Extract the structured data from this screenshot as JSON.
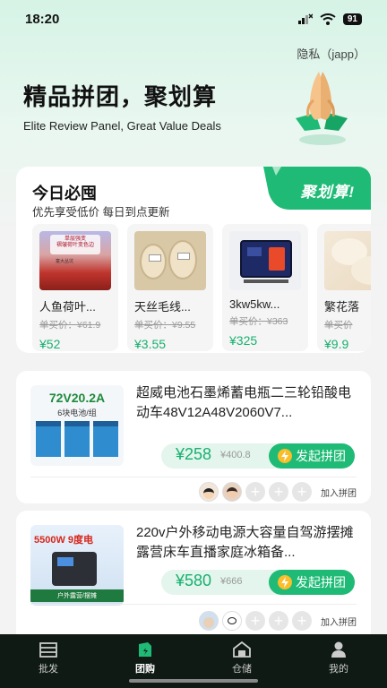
{
  "status": {
    "time": "18:20",
    "battery": "91"
  },
  "header": {
    "privacy": "隐私（japp）",
    "title": "精品拼团，聚划算",
    "subtitle": "Elite Review Panel, Great Value Deals"
  },
  "daily": {
    "title": "今日必囤",
    "subtitle": "优先享受低价 每日到点更新",
    "ribbon": "聚划算!",
    "products": [
      {
        "name": "人鱼荷叶...",
        "orig": "单买价：¥61.9",
        "price": "¥52"
      },
      {
        "name": "天丝毛线...",
        "orig": "单买价：¥9.55",
        "price": "¥3.55"
      },
      {
        "name": "3kw5kw...",
        "orig": "单买价：¥363",
        "price": "¥325"
      },
      {
        "name": "繁花落",
        "orig": "单买价",
        "price": "¥9.9"
      }
    ],
    "thumb_texts": {
      "p1a": "单层强变",
      "p1b": "褶皱荷叶变色边",
      "p1c": "童大丛坑"
    }
  },
  "deals": [
    {
      "title": "超威电池石墨烯蓄电瓶二三轮铅酸电动车48V12A48V2060V7...",
      "price": "¥258",
      "orig": "¥400.8",
      "button": "发起拼团",
      "join": "加入拼团",
      "thumb_a": "72V20.2A",
      "thumb_b": "6块电池/组"
    },
    {
      "title": "220v户外移动电源大容量自驾游摆摊露营床车直播家庭冰箱备...",
      "price": "¥580",
      "orig": "¥666",
      "button": "发起拼团",
      "join": "加入拼团",
      "thumb_a": "5500W 9度电",
      "thumb_b": "户外露营/摆摊"
    }
  ],
  "tabs": [
    {
      "label": "批发",
      "icon": "warehouse-icon"
    },
    {
      "label": "团购",
      "icon": "group-buy-icon",
      "active": true
    },
    {
      "label": "仓储",
      "icon": "home-storage-icon"
    },
    {
      "label": "我的",
      "icon": "user-icon"
    }
  ],
  "colors": {
    "accent": "#1fbb76",
    "price": "#18b070",
    "tabbar": "#0f1a14"
  }
}
